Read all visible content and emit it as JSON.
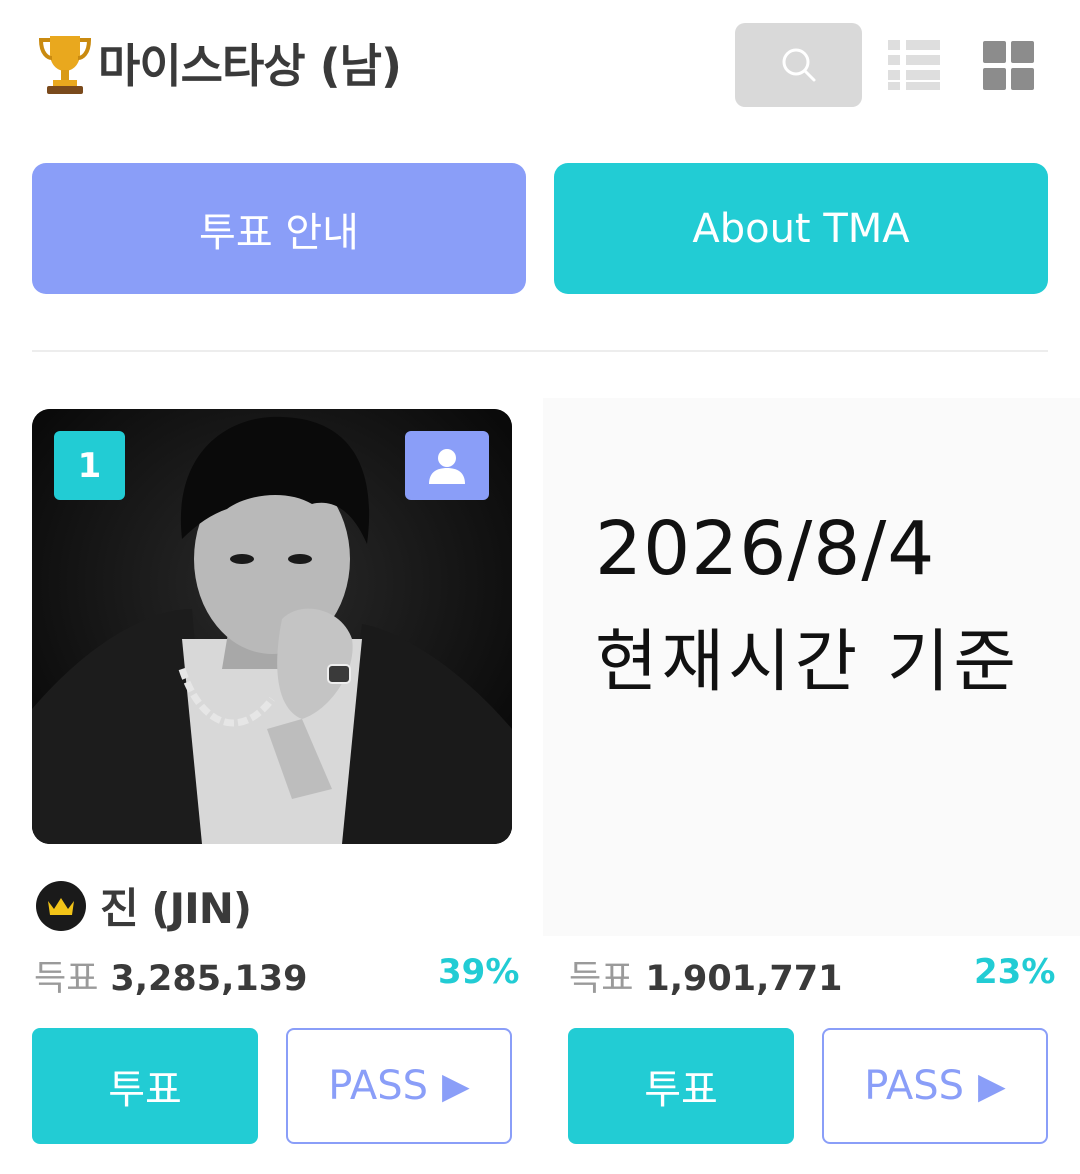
{
  "header": {
    "title": "마이스타상 (남)",
    "icons": [
      "trophy-icon",
      "search-icon",
      "list-view-icon",
      "grid-view-icon"
    ]
  },
  "buttons": {
    "guide": "투표 안내",
    "about": "About TMA"
  },
  "candidates": [
    {
      "rank": "1",
      "name": "진 (JIN)",
      "votes_label": "득표",
      "votes": "3,285,139",
      "percent": "39%",
      "vote_button": "투표",
      "pass_button": "PASS"
    },
    {
      "votes_label": "득표",
      "votes": "1,901,771",
      "percent": "23%",
      "vote_button": "투표",
      "pass_button": "PASS"
    }
  ],
  "note": {
    "date": "2026/8/4",
    "text": "현재시간 기준"
  },
  "colors": {
    "accent_teal": "#22ccd4",
    "accent_purple": "#8a9ef8",
    "search_bg": "#d9d9d9"
  }
}
